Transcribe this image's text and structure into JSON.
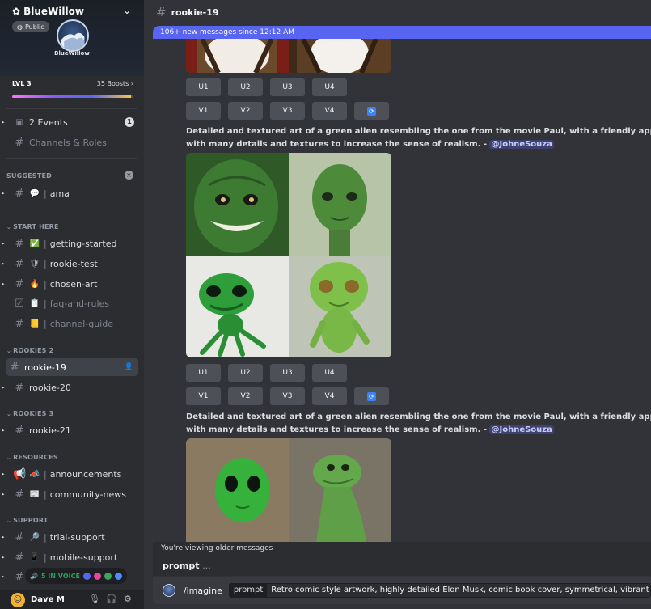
{
  "server": {
    "name": "BlueWillow",
    "public_label": "Public",
    "logo_text": "BlueWillow",
    "level": "LVL 3",
    "boosts": "35 Boosts",
    "boost_progress": 0.98
  },
  "sidebar": {
    "events": {
      "label": "2 Events",
      "count": "1"
    },
    "channels_roles": "Channels & Roles",
    "categories": {
      "suggested": "SUGGESTED",
      "start_here": "START HERE",
      "rookies2": "ROOKIES 2",
      "rookies3": "ROOKIES 3",
      "resources": "RESOURCES",
      "support": "SUPPORT"
    },
    "channels": {
      "ama": "ama",
      "getting_started": "getting-started",
      "rookie_test": "rookie-test",
      "chosen_art": "chosen-art",
      "faq": "faq-and-rules",
      "guide": "channel-guide",
      "rookie19": "rookie-19",
      "rookie20": "rookie-20",
      "rookie21": "rookie-21",
      "announcements": "announcements",
      "community_news": "community-news",
      "trial_support": "trial-support",
      "mobile_support": "mobile-support"
    },
    "voice_label": "5 IN VOICE"
  },
  "user": {
    "name": "Dave M"
  },
  "channel": {
    "name": "rookie-19",
    "new_messages": "106+ new messages since 12:12 AM"
  },
  "buttons": {
    "upscale": [
      "U1",
      "U2",
      "U3",
      "U4"
    ],
    "variation": [
      "V1",
      "V2",
      "V3",
      "V4"
    ]
  },
  "messages": {
    "prompt_line1": "Detailed and textured art of a green alien resembling the one from the movie Paul, with a friendly appearance and",
    "prompt_line2": "with many details and textures to increase the sense of realism. -",
    "mention": "@JohneSouza"
  },
  "composer": {
    "older_notice": "You're viewing older messages",
    "hint_name": "prompt",
    "hint_dots": "...",
    "command": "/imagine",
    "option_key": "prompt",
    "option_value": "Retro comic style artwork, highly detailed Elon Musk, comic book cover, symmetrical, vibrant"
  },
  "colors": {
    "sidebar_bg": "#2b2d31",
    "main_bg": "#313338",
    "blurple": "#5865f2",
    "button_bg": "#4e5058",
    "voice_green": "#23a55a"
  }
}
